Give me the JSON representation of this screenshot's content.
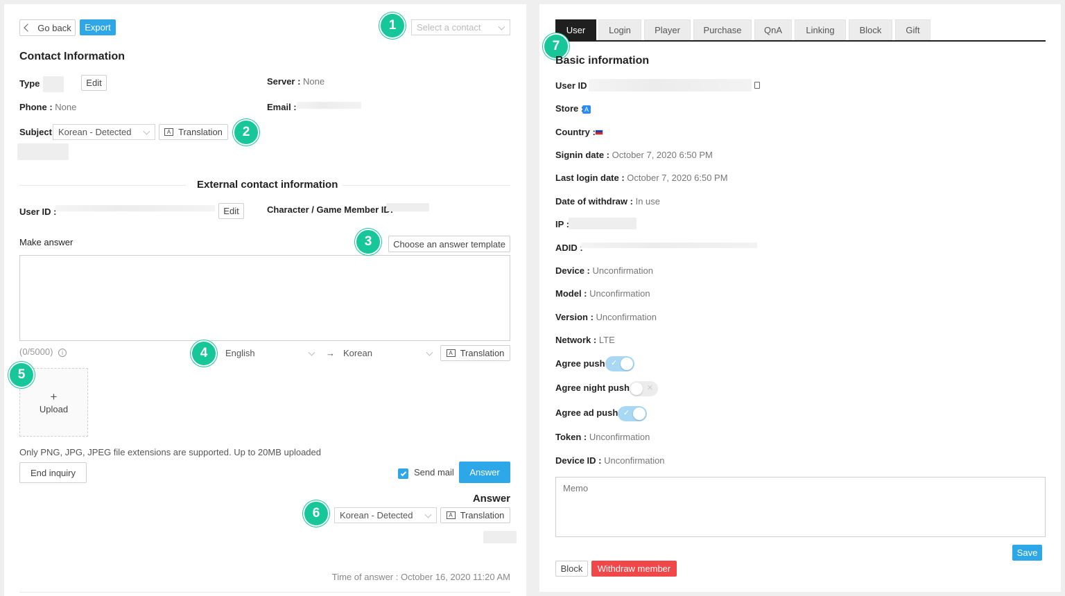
{
  "left": {
    "go_back": "Go back",
    "export": "Export",
    "select_contact_placeholder": "Select a contact",
    "contact_info_title": "Contact Information",
    "type_label": "Type :",
    "edit": "Edit",
    "server_label": "Server :",
    "server_value": "None",
    "phone_label": "Phone :",
    "phone_value": "None",
    "email_label": "Email :",
    "subject_label": "Subject",
    "subject_lang": "Korean - Detected",
    "translation": "Translation",
    "external_title": "External contact information",
    "user_id_label": "User ID :",
    "character_label": "Character / Game Member ID:",
    "make_answer": "Make answer",
    "choose_template": "Choose an answer template",
    "char_count": "(0/5000)",
    "from_lang": "English",
    "arrow": "→",
    "to_lang": "Korean",
    "upload_plus": "+",
    "upload": "Upload",
    "file_note": "Only PNG, JPG, JPEG file extensions are supported. Up to 20MB uploaded",
    "end_inquiry": "End inquiry",
    "send_mail": "Send mail",
    "send_mail_checked": true,
    "answer_btn": "Answer",
    "answer_title": "Answer",
    "answer_lang": "Korean - Detected",
    "time_of_answer": "Time of answer : October 16, 2020 11:20 AM"
  },
  "badges": [
    "1",
    "2",
    "3",
    "4",
    "5",
    "6",
    "7"
  ],
  "right": {
    "tabs": [
      "User",
      "Login",
      "Player",
      "Purchase",
      "QnA",
      "Linking",
      "Block",
      "Gift"
    ],
    "active_tab": "User",
    "basic_info_title": "Basic information",
    "user_id_label": "User ID :",
    "store_label": "Store :",
    "country_label": "Country :",
    "signin_label": "Signin date :",
    "signin_value": "October 7, 2020 6:50 PM",
    "last_login_label": "Last login date :",
    "last_login_value": "October 7, 2020 6:50 PM",
    "withdraw_label": "Date of withdraw :",
    "withdraw_value": "In use",
    "ip_label": "IP :",
    "adid_label": "ADID :",
    "device_label": "Device :",
    "device_value": "Unconfirmation",
    "model_label": "Model :",
    "model_value": "Unconfirmation",
    "version_label": "Version :",
    "version_value": "Unconfirmation",
    "network_label": "Network :",
    "network_value": "LTE",
    "agree_push_label": "Agree push :",
    "agree_push": true,
    "agree_night_push_label": "Agree night push :",
    "agree_night_push": false,
    "agree_ad_push_label": "Agree ad push :",
    "agree_ad_push": true,
    "token_label": "Token :",
    "token_value": "Unconfirmation",
    "device_id_label": "Device ID :",
    "device_id_value": "Unconfirmation",
    "memo_placeholder": "Memo",
    "save": "Save",
    "block": "Block",
    "withdraw_member": "Withdraw member"
  },
  "colors": {
    "accent": "#2ea7e8",
    "danger": "#f14748",
    "badge": "#17c79a",
    "tab_active": "#1f1f1f"
  }
}
